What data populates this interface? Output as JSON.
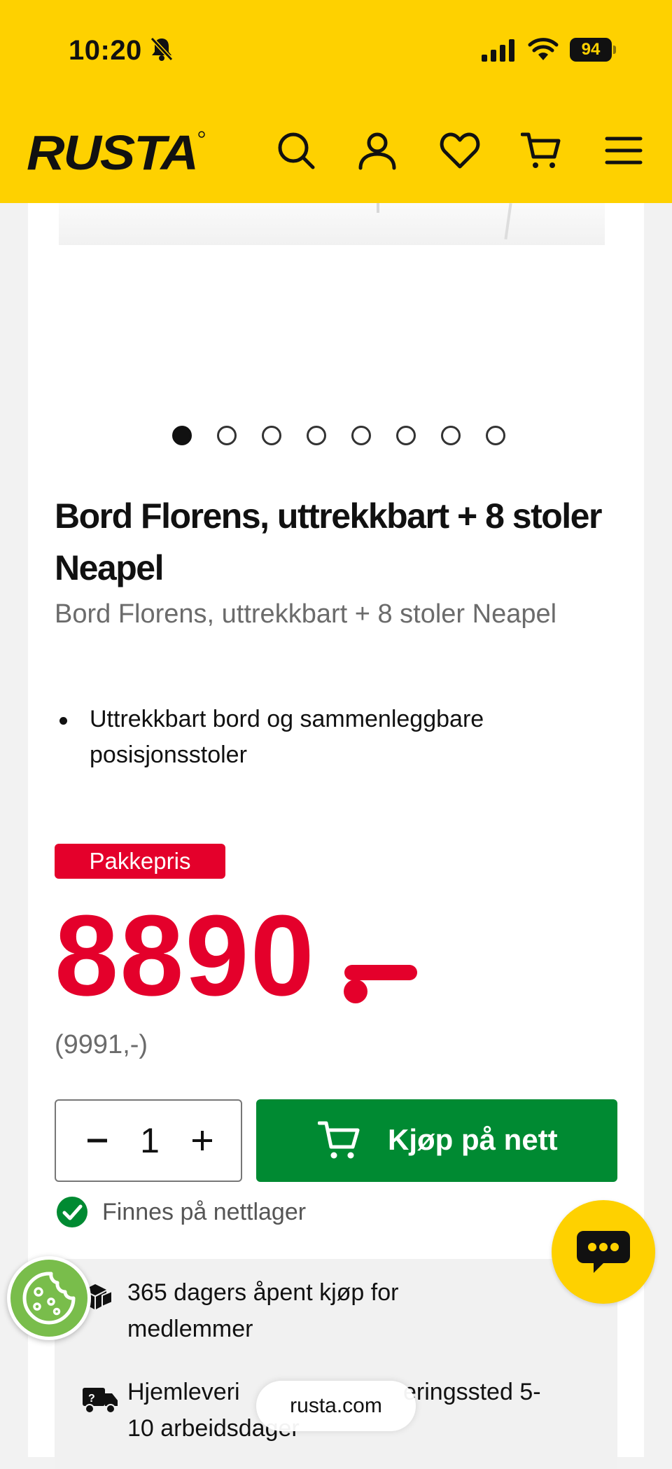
{
  "status_bar": {
    "time": "10:20",
    "battery": "94",
    "icons": [
      "bell-slash-icon",
      "signal-icon",
      "wifi-icon",
      "battery-icon"
    ]
  },
  "header": {
    "logo_text": "RUSTA",
    "icons": [
      "search-icon",
      "user-icon",
      "heart-icon",
      "cart-icon",
      "menu-icon"
    ],
    "brand_color": "#fed100"
  },
  "gallery": {
    "image_count": 8,
    "active_index": 0
  },
  "product": {
    "title": "Bord Florens, uttrekkbart + 8 stoler Neapel",
    "subtitle": "Bord Florens, uttrekkbart + 8 stoler Neapel",
    "bullets": [
      "Uttrekkbart bord og sammenleggbare posisjonsstoler"
    ],
    "badge": "Pakkepris",
    "price": "8890",
    "original_price": "(9991,-)",
    "price_color": "#e4002b"
  },
  "purchase": {
    "quantity": "1",
    "buy_label": "Kjøp på nett",
    "buy_color": "#008a32",
    "stock_text": "Finnes på nettlager"
  },
  "info": {
    "items": [
      {
        "icon": "boxes-icon",
        "text": "365 dagers åpent kjøp for medlemmer"
      },
      {
        "icon": "delivery-truck-icon",
        "text": "Hjemleveri",
        "text_tail": "eringssted 5-",
        "text_line2": "10 arbeidsdager"
      }
    ]
  },
  "browser": {
    "url": "rusta.com"
  }
}
